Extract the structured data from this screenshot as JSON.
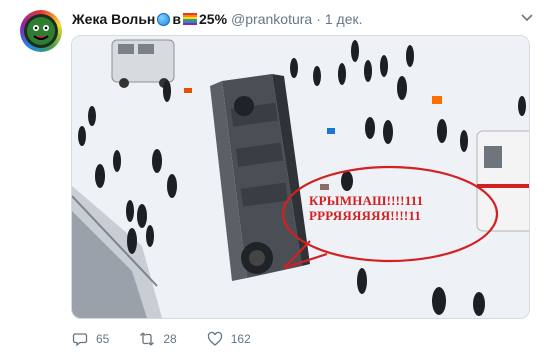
{
  "tweet": {
    "author_name": "Жека Вольн",
    "author_name_suffix": "в",
    "percent": "25%",
    "handle": "@prankotura",
    "separator": "·",
    "date": "1 дек.",
    "media": {
      "overlay_line1": "КРЫМНАШ!!!!111",
      "overlay_line2": "РРРЯЯЯЯЯЯ!!!!11"
    },
    "actions": {
      "replies": "65",
      "retweets": "28",
      "likes": "162"
    }
  },
  "icons": {
    "avatar": "avatar-image",
    "globe": "globe-icon",
    "rainbow": "rainbow-flag-icon",
    "caret": "chevron-down-icon",
    "reply": "reply-icon",
    "retweet": "retweet-icon",
    "like": "heart-icon"
  },
  "colors": {
    "name": "#14171a",
    "secondary": "#657786",
    "overlay_text": "#d32020",
    "overlay_ellipse": "#d32020"
  }
}
